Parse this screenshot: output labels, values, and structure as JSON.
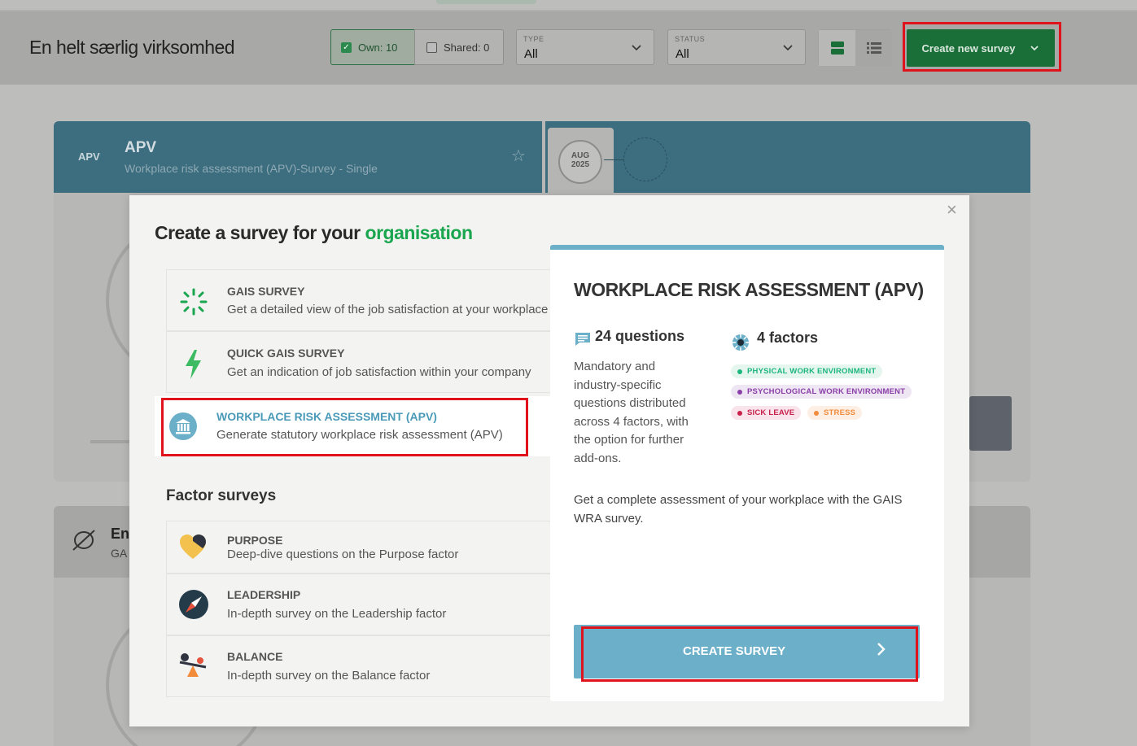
{
  "header": {
    "org_name": "En helt særlig virksomhed",
    "own_filter": "Own: 10",
    "shared_filter": "Shared: 0",
    "type_label": "TYPE",
    "type_value": "All",
    "status_label": "STATUS",
    "status_value": "All",
    "create_new_label": "Create new survey"
  },
  "background_cards": [
    {
      "tag": "APV",
      "title": "APV",
      "subtitle": "Workplace risk assessment (APV)-Survey - Single",
      "date_month": "AUG",
      "date_year": "2025"
    },
    {
      "title": "En",
      "subtitle": "GA"
    }
  ],
  "modal": {
    "title_prefix": "Create a survey for your",
    "title_accent": "organisation",
    "surveys": [
      {
        "title": "GAIS SURVEY",
        "desc": "Get a detailed view of the job satisfaction at your workplace",
        "icon": "gais-spinner-icon"
      },
      {
        "title": "QUICK GAIS SURVEY",
        "desc": "Get an indication of job satisfaction within your company",
        "icon": "lightning-icon"
      },
      {
        "title": "WORKPLACE RISK ASSESSMENT (APV)",
        "desc": "Generate statutory workplace risk assessment (APV)",
        "icon": "bank-building-icon"
      }
    ],
    "factor_title": "Factor surveys",
    "factor_surveys": [
      {
        "title": "PURPOSE",
        "desc": "Deep-dive questions on the Purpose factor",
        "icon": "heart-icon"
      },
      {
        "title": "LEADERSHIP",
        "desc": "In-depth survey on the Leadership factor",
        "icon": "compass-icon"
      },
      {
        "title": "BALANCE",
        "desc": "In-depth survey on the Balance factor",
        "icon": "seesaw-icon"
      }
    ],
    "detail": {
      "title": "WORKPLACE RISK ASSESSMENT (APV)",
      "questions": "24 questions",
      "factors": "4 factors",
      "questions_desc": "Mandatory and industry-specific questions distributed across 4 factors, with the option for further add-ons.",
      "factor_tags": [
        {
          "label": "PHYSICAL WORK ENVIRONMENT",
          "color": "#1fb67e",
          "bg": "#e4f6ee"
        },
        {
          "label": "PSYCHOLOGICAL WORK ENVIRONMENT",
          "color": "#8a3fa8",
          "bg": "#efe6f3"
        },
        {
          "label": "SICK LEAVE",
          "color": "#c9204c",
          "bg": "#f8e4ea"
        },
        {
          "label": "STRESS",
          "color": "#f08c3c",
          "bg": "#fdefe4"
        }
      ],
      "long_desc": "Get a complete assessment of your workplace with the GAIS WRA survey.",
      "create_label": "CREATE SURVEY"
    }
  },
  "colors": {
    "accent_green": "#1aa54f",
    "accent_blue": "#6cafc8",
    "highlight_red": "#e0121c"
  }
}
